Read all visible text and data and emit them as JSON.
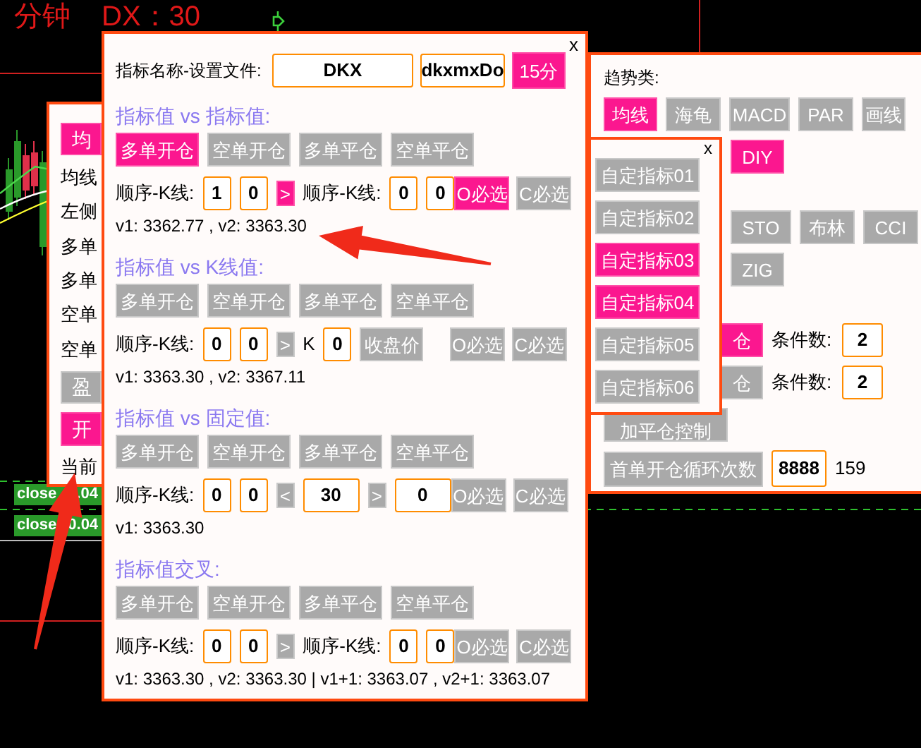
{
  "chart": {
    "timeframe": "分钟",
    "indicator": "DX：30"
  },
  "order_tags": [
    [
      "close",
      ".04"
    ],
    [
      "close",
      "0.04"
    ]
  ],
  "left_panel": {
    "items": [
      {
        "kind": "button",
        "label": "均",
        "selected": true
      },
      {
        "kind": "text",
        "label": "均线"
      },
      {
        "kind": "text",
        "label": "左侧"
      },
      {
        "kind": "text",
        "label": "多单"
      },
      {
        "kind": "text",
        "label": "多单"
      },
      {
        "kind": "text",
        "label": "空单"
      },
      {
        "kind": "text",
        "label": "空单"
      },
      {
        "kind": "button",
        "label": "盈",
        "selected": false
      },
      {
        "kind": "button",
        "label": "开",
        "selected": true
      },
      {
        "kind": "text",
        "label": "当前"
      }
    ]
  },
  "trend_panel": {
    "title": "趋势类:",
    "indicator_rows": [
      [
        {
          "label": "均线",
          "selected": true
        },
        {
          "label": "海龟",
          "selected": false
        },
        {
          "label": "MACD",
          "selected": false
        },
        {
          "label": "PAR",
          "selected": false
        },
        {
          "label": "画线",
          "selected": false
        }
      ],
      [
        {
          "label": "DIY",
          "selected": true
        }
      ],
      [
        {
          "label": "STO",
          "selected": false
        },
        {
          "label": "布林",
          "selected": false
        },
        {
          "label": "CCI",
          "selected": false
        }
      ],
      [
        {
          "label": "ZIG",
          "selected": false
        }
      ]
    ],
    "conditions": [
      {
        "action": {
          "label": "仓",
          "selected": true
        },
        "label": "条件数:",
        "value": "2"
      },
      {
        "action": {
          "label": "仓",
          "selected": false
        },
        "label": "条件数:",
        "value": "2"
      }
    ],
    "control": {
      "label": "加平仓控制",
      "selected": false
    },
    "loop": {
      "label": "首单开仓循环次数",
      "selected": false,
      "value": "8888",
      "count": "159"
    }
  },
  "custom_panel": {
    "close": "x",
    "items": [
      {
        "label": "自定指标01",
        "selected": false
      },
      {
        "label": "自定指标02",
        "selected": false
      },
      {
        "label": "自定指标03",
        "selected": true
      },
      {
        "label": "自定指标04",
        "selected": true
      },
      {
        "label": "自定指标05",
        "selected": false
      },
      {
        "label": "自定指标06",
        "selected": false
      }
    ]
  },
  "main_window": {
    "close": "x",
    "header": {
      "label": "指标名称-设置文件:",
      "name": "DKX",
      "file": "dkxmxDo",
      "timeframe": {
        "label": "15分",
        "selected": true
      }
    },
    "sections": [
      {
        "title": "指标值 vs 指标值:",
        "actions": [
          {
            "label": "多单开仓",
            "selected": true
          },
          {
            "label": "空单开仓",
            "selected": false
          },
          {
            "label": "多单平仓",
            "selected": false
          },
          {
            "label": "空单平仓",
            "selected": false
          }
        ],
        "inputs": [
          {
            "kind": "label",
            "text": "顺序-K线:"
          },
          {
            "kind": "field",
            "value": "1"
          },
          {
            "kind": "field",
            "value": "0"
          },
          {
            "kind": "operator",
            "label": ">",
            "selected": true
          },
          {
            "kind": "label",
            "text": "顺序-K线:"
          },
          {
            "kind": "field",
            "value": "0"
          },
          {
            "kind": "field",
            "value": "0"
          }
        ],
        "choices": [
          {
            "label": "O必选",
            "selected": true
          },
          {
            "label": "C必选",
            "selected": false
          }
        ],
        "readout": "v1: 3362.77 , v2: 3363.30"
      },
      {
        "title": "指标值 vs K线值:",
        "actions": [
          {
            "label": "多单开仓",
            "selected": false
          },
          {
            "label": "空单开仓",
            "selected": false
          },
          {
            "label": "多单平仓",
            "selected": false
          },
          {
            "label": "空单平仓",
            "selected": false
          }
        ],
        "inputs": [
          {
            "kind": "label",
            "text": "顺序-K线:"
          },
          {
            "kind": "field",
            "value": "0"
          },
          {
            "kind": "field",
            "value": "0"
          },
          {
            "kind": "operator",
            "label": ">",
            "selected": false
          },
          {
            "kind": "label",
            "text": "K"
          },
          {
            "kind": "field",
            "value": "0"
          },
          {
            "kind": "button",
            "label": "收盘价",
            "selected": false
          }
        ],
        "choices": [
          {
            "label": "O必选",
            "selected": false
          },
          {
            "label": "C必选",
            "selected": false
          }
        ],
        "readout": "v1: 3363.30 , v2: 3367.11"
      },
      {
        "title": "指标值 vs 固定值:",
        "actions": [
          {
            "label": "多单开仓",
            "selected": false
          },
          {
            "label": "空单开仓",
            "selected": false
          },
          {
            "label": "多单平仓",
            "selected": false
          },
          {
            "label": "空单平仓",
            "selected": false
          }
        ],
        "inputs": [
          {
            "kind": "label",
            "text": "顺序-K线:"
          },
          {
            "kind": "field",
            "value": "0"
          },
          {
            "kind": "field",
            "value": "0"
          },
          {
            "kind": "operator",
            "label": "<",
            "selected": false
          },
          {
            "kind": "wide_field",
            "value": "30"
          },
          {
            "kind": "operator",
            "label": ">",
            "selected": false
          },
          {
            "kind": "wide_field",
            "value": "0"
          }
        ],
        "choices": [
          {
            "label": "O必选",
            "selected": false
          },
          {
            "label": "C必选",
            "selected": false
          }
        ],
        "readout": "v1: 3363.30"
      },
      {
        "title": "指标值交叉:",
        "actions": [
          {
            "label": "多单开仓",
            "selected": false
          },
          {
            "label": "空单开仓",
            "selected": false
          },
          {
            "label": "多单平仓",
            "selected": false
          },
          {
            "label": "空单平仓",
            "selected": false
          }
        ],
        "inputs": [
          {
            "kind": "label",
            "text": "顺序-K线:"
          },
          {
            "kind": "field",
            "value": "0"
          },
          {
            "kind": "field",
            "value": "0"
          },
          {
            "kind": "operator",
            "label": ">",
            "selected": false
          },
          {
            "kind": "label",
            "text": "顺序-K线:"
          },
          {
            "kind": "field",
            "value": "0"
          },
          {
            "kind": "field",
            "value": "0"
          }
        ],
        "choices": [
          {
            "label": "O必选",
            "selected": false
          },
          {
            "label": "C必选",
            "selected": false
          }
        ],
        "readout": "v1: 3363.30 , v2: 3363.30 | v1+1: 3363.07 , v2+1: 3363.07"
      }
    ]
  }
}
